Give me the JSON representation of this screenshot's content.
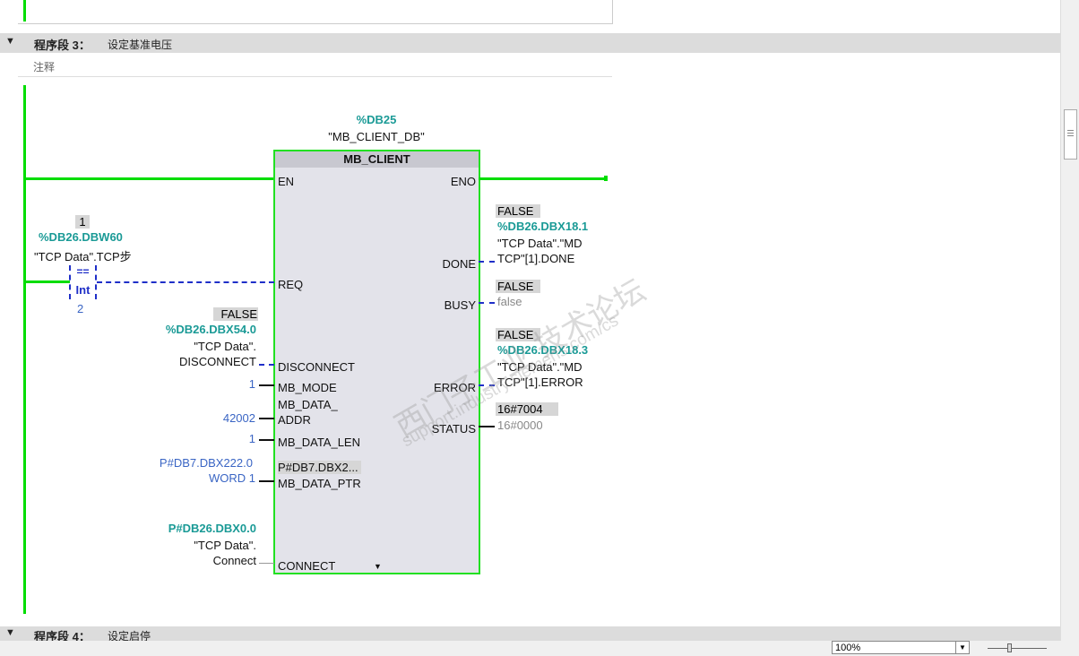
{
  "network3": {
    "label": "程序段 3：",
    "title": "设定基准电压",
    "comment": "注释"
  },
  "network4": {
    "label": "程序段 4：",
    "title": "设定启停"
  },
  "instance": {
    "db": "%DB25",
    "name": "\"MB_CLIENT_DB\""
  },
  "block": {
    "title": "MB_CLIENT",
    "pins": {
      "en": "EN",
      "eno": "ENO",
      "req": "REQ",
      "disconnect": "DISCONNECT",
      "mb_mode": "MB_MODE",
      "mb_data_addr_1": "MB_DATA_",
      "mb_data_addr_2": "ADDR",
      "mb_data_len": "MB_DATA_LEN",
      "mb_data_ptr": "MB_DATA_PTR",
      "connect": "CONNECT",
      "done": "DONE",
      "busy": "BUSY",
      "error": "ERROR",
      "status": "STATUS"
    },
    "ptr_preview": "P#DB7.DBX2..."
  },
  "compare": {
    "value": "1",
    "address": "%DB26.DBW60",
    "symbol": "\"TCP Data\".TCP步",
    "op": "==",
    "type": "Int",
    "operand2": "2"
  },
  "inputs": {
    "disconnect": {
      "state": "FALSE",
      "address": "%DB26.DBX54.0",
      "sym1": "\"TCP Data\".",
      "sym2": "DISCONNECT"
    },
    "mb_mode": "1",
    "mb_data_addr": "42002",
    "mb_data_len": "1",
    "mb_data_ptr": {
      "line1": "P#DB7.DBX222.0",
      "line2": "WORD 1"
    },
    "connect": {
      "address": "P#DB26.DBX0.0",
      "sym1": "\"TCP Data\".",
      "sym2": "Connect"
    }
  },
  "outputs": {
    "done": {
      "state": "FALSE",
      "address": "%DB26.DBX18.1",
      "sym1": "\"TCP Data\".\"MD",
      "sym2": "TCP\"[1].DONE"
    },
    "busy": {
      "state": "FALSE",
      "value": "false"
    },
    "error": {
      "state": "FALSE",
      "address": "%DB26.DBX18.3",
      "sym1": "\"TCP Data\".\"MD",
      "sym2": "TCP\"[1].ERROR"
    },
    "status": {
      "current": "16#7004",
      "value": "16#0000"
    }
  },
  "watermark": {
    "line1": "西门子工业  技术论坛",
    "line2": "support.industry.siemens.com/cs"
  },
  "zoom": {
    "value": "100%"
  }
}
